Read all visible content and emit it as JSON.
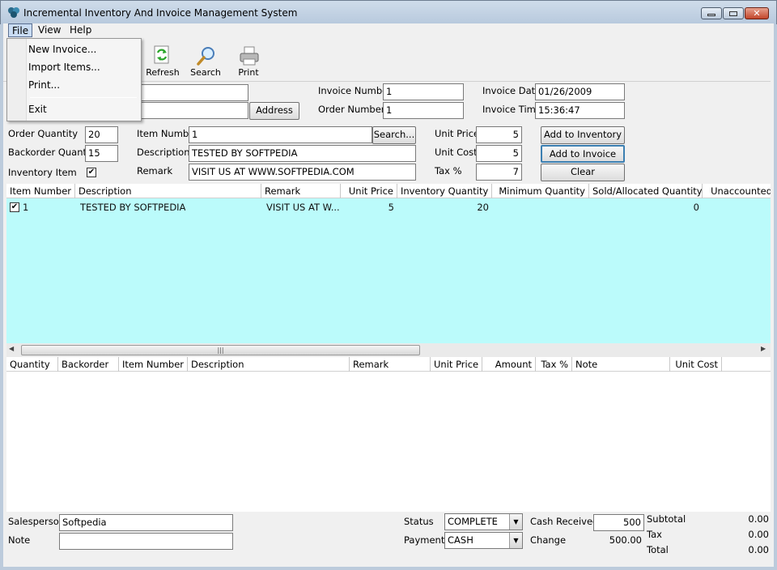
{
  "window": {
    "title": "Incremental Inventory And Invoice Management System"
  },
  "menubar": {
    "file": "File",
    "view": "View",
    "help": "Help"
  },
  "file_menu": {
    "items": [
      "New Invoice...",
      "Import Items...",
      "Print...",
      "Exit"
    ]
  },
  "toolbar": {
    "refresh": "Refresh",
    "search": "Search",
    "print": "Print"
  },
  "customer": {
    "address_button": "Address",
    "field1": "",
    "field2": ""
  },
  "invoice": {
    "number_label": "Invoice Number",
    "number": "1",
    "order_label": "Order Number",
    "order": "1",
    "date_label": "Invoice Date",
    "date": "01/26/2009",
    "time_label": "Invoice Time",
    "time": "15:36:47"
  },
  "item_form": {
    "order_qty_label": "Order Quantity",
    "order_qty": "20",
    "backorder_qty_label": "Backorder Quantity",
    "backorder_qty": "15",
    "inventory_item_label": "Inventory Item",
    "inventory_item_checked": true,
    "item_number_label": "Item Number",
    "item_number": "1",
    "search_button": "Search...",
    "description_label": "Description",
    "description": "TESTED BY SOFTPEDIA",
    "remark_label": "Remark",
    "remark": "VISIT US AT WWW.SOFTPEDIA.COM",
    "unit_price_label": "Unit Price",
    "unit_price": "5",
    "unit_cost_label": "Unit Cost",
    "unit_cost": "5",
    "tax_label": "Tax %",
    "tax": "7",
    "add_inventory_button": "Add to Inventory",
    "add_invoice_button": "Add to Invoice",
    "clear_button": "Clear"
  },
  "inventory_grid": {
    "columns": [
      "Item Number",
      "Description",
      "Remark",
      "Unit Price",
      "Inventory Quantity",
      "Minimum Quantity",
      "Sold/Allocated Quantity",
      "Unaccounted"
    ],
    "rows": [
      {
        "checked": true,
        "item_number": "1",
        "description": "TESTED BY SOFTPEDIA",
        "remark": "VISIT US AT W...",
        "unit_price": "5",
        "inventory_quantity": "20",
        "minimum_quantity": "",
        "sold_allocated": "0"
      }
    ],
    "background": "#bbfbfb"
  },
  "invoice_grid": {
    "columns": [
      "Quantity",
      "Backorder",
      "Item Number",
      "Description",
      "Remark",
      "Unit Price",
      "Amount",
      "Tax %",
      "Note",
      "Unit Cost"
    ]
  },
  "footer": {
    "salesperson_label": "Salesperson",
    "salesperson": "Softpedia",
    "note_label": "Note",
    "note": "",
    "status_label": "Status",
    "status": "COMPLETE",
    "payment_label": "Payment",
    "payment": "CASH",
    "cash_received_label": "Cash Received",
    "cash_received": "500",
    "change_label": "Change",
    "change": "500.00",
    "subtotal_label": "Subtotal",
    "subtotal": "0.00",
    "tax_label": "Tax",
    "tax": "0.00",
    "total_label": "Total",
    "total": "0.00"
  }
}
